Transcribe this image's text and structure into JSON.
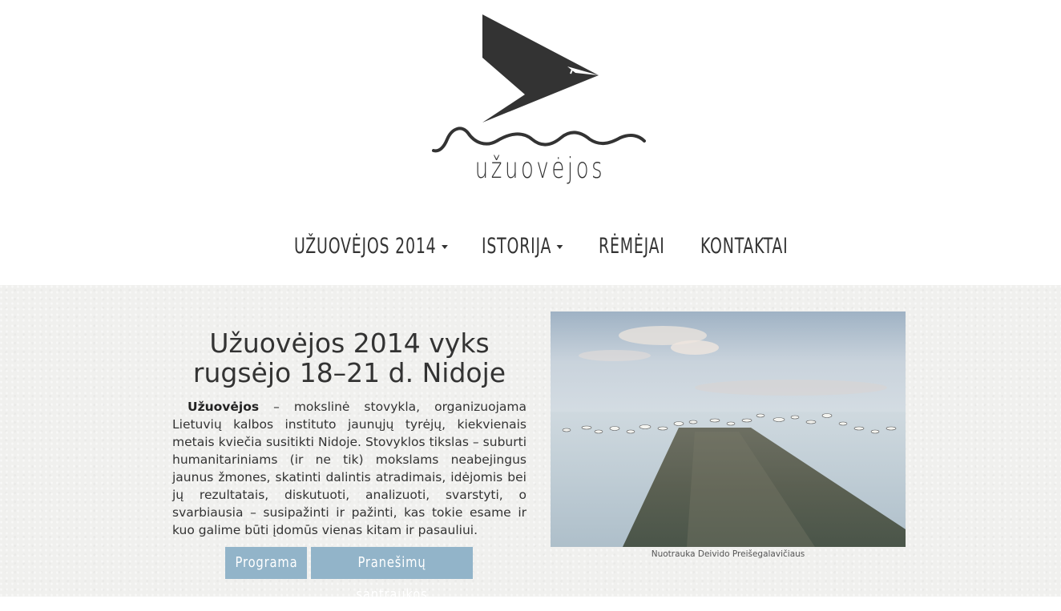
{
  "site": {
    "logo_text": "užuovėjos",
    "colors": {
      "logo": "#333333",
      "button_bg": "#92b4c9",
      "content_bg": "#f0f0ee"
    }
  },
  "nav": {
    "items": [
      {
        "label": "UŽUOVĖJOS 2014",
        "has_dropdown": true
      },
      {
        "label": "ISTORIJA",
        "has_dropdown": true
      },
      {
        "label": "RĖMĖJAI",
        "has_dropdown": false
      },
      {
        "label": "KONTAKTAI",
        "has_dropdown": false
      }
    ]
  },
  "main": {
    "headline_line1": "Užuovėjos 2014 vyks",
    "headline_line2": "rugsėjo 18–21 d. Nidoje",
    "intro_bold": "Užuovėjos",
    "intro_text": " – mokslinė stovykla, organizuojama Lietuvių kalbos instituto jaunųjų tyrėjų, kiekvienais metais kviečia susitikti Nidoje. Stovyklos tikslas – suburti humanitariniams (ir ne tik) mokslams neabejingus jaunus žmones, skatinti dalintis atradimais, idėjomis bei jų rezultatais, diskutuoti, analizuoti, svarstyti, o svarbiausia – susipažinti ir pažinti, kas tokie esame ir kuo galime būti įdomūs vienas kitam ir pasauliui.",
    "buttons": {
      "program_label": "Programa",
      "abstracts_label": "Pranešimų santraukos"
    },
    "photo_caption": "Nuotrauka Deivido Preišegalavičiaus"
  }
}
